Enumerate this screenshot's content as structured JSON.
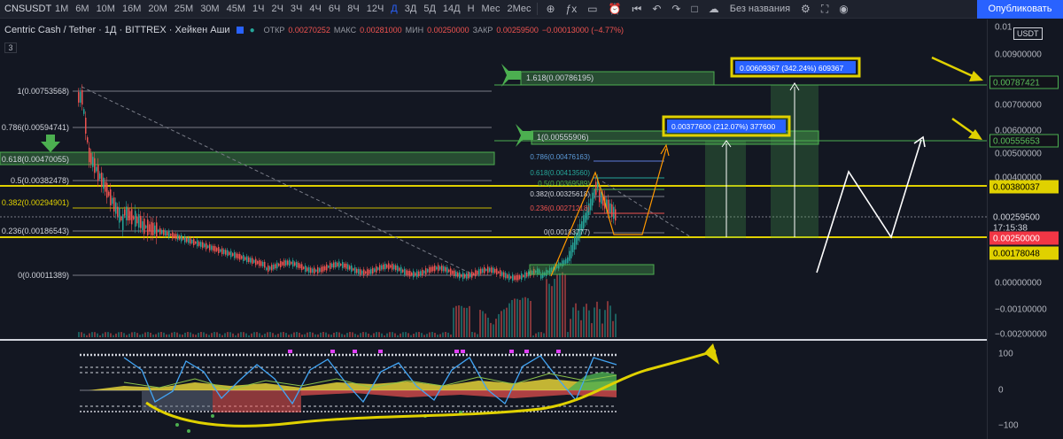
{
  "toolbar": {
    "symbol": "CNSUSDT",
    "intervals": [
      "1М",
      "6М",
      "10М",
      "16М",
      "20М",
      "25М",
      "30М",
      "45М",
      "1Ч",
      "2Ч",
      "3Ч",
      "4Ч",
      "6Ч",
      "8Ч",
      "12Ч",
      "Д",
      "3Д",
      "5Д",
      "14Д",
      "Н",
      "Мес",
      "2Мес"
    ],
    "active_interval": "Д",
    "layout_name": "Без названия",
    "publish_label": "Опубликовать"
  },
  "legend": {
    "title": "Centric Cash / Tether · 1Д · BITTREX · Хейкен Аши",
    "open_label": "ОТКР",
    "open_value": "0.00270252",
    "high_label": "МАКС",
    "high_value": "0.00281000",
    "low_label": "МИН",
    "low_value": "0.00250000",
    "close_label": "ЗАКР",
    "close_value": "0.00259500",
    "change": "−0.00013000 (−4.77%)",
    "indicator_count": "3"
  },
  "price_scale": {
    "currency": "USDT",
    "ticks": [
      "0.01",
      "0.00900000",
      "0.00700000",
      "0.00600000",
      "0.00500000",
      "0.00400000",
      "0.00200000",
      "0.00100000",
      "0.00000000",
      "−0.00100000",
      "−0.00200000"
    ],
    "indicator_ticks": [
      "100",
      "0",
      "−100"
    ],
    "tags": [
      {
        "value": "0.00787421",
        "bg": "#12121a",
        "fg": "#5bbf5b",
        "border": "#4caf50"
      },
      {
        "value": "0.00555653",
        "bg": "#12121a",
        "fg": "#5bbf5b",
        "border": "#4caf50"
      },
      {
        "value": "0.00380037",
        "bg": "#e0d100",
        "fg": "#000000",
        "border": "#e0d100"
      },
      {
        "value": "0.00259500",
        "bg": "#131722",
        "fg": "#d1d4dc",
        "border": "#131722"
      },
      {
        "value": "17:15:38",
        "bg": "#131722",
        "fg": "#d1d4dc",
        "border": "#131722"
      },
      {
        "value": "0.00250000",
        "bg": "#f23645",
        "fg": "#ffffff",
        "border": "#f23645"
      },
      {
        "value": "0.00178048",
        "bg": "#e0d100",
        "fg": "#000000",
        "border": "#e0d100"
      }
    ]
  },
  "fib_left": [
    "1(0.00753568)",
    "0.786(0.00594741)",
    "0.618(0.00470055)",
    "0.5(0.00382478)",
    "0.382(0.00294901)",
    "0.236(0.00186543)",
    "0(0.00011389)"
  ],
  "fib_right": [
    "0.786(0.00476163)",
    "0.618(0.00413560)",
    "0.5(0.00369589)",
    "0.382(0.00325618)",
    "0.236(0.00271218)",
    "0(0.00183777)"
  ],
  "fib_ext": [
    "1.618(0.00786195)",
    "1(0.00555906)"
  ],
  "targets": [
    {
      "text": "0.00609367 (342.24%) 609367"
    },
    {
      "text": "0.00377600 (212.07%) 377600"
    }
  ],
  "colors": {
    "bg": "#131722",
    "up": "#26a69a",
    "down": "#ef5350",
    "annotation": "#ffeb3b",
    "fib_green": "#4caf50",
    "accent": "#2962ff"
  }
}
